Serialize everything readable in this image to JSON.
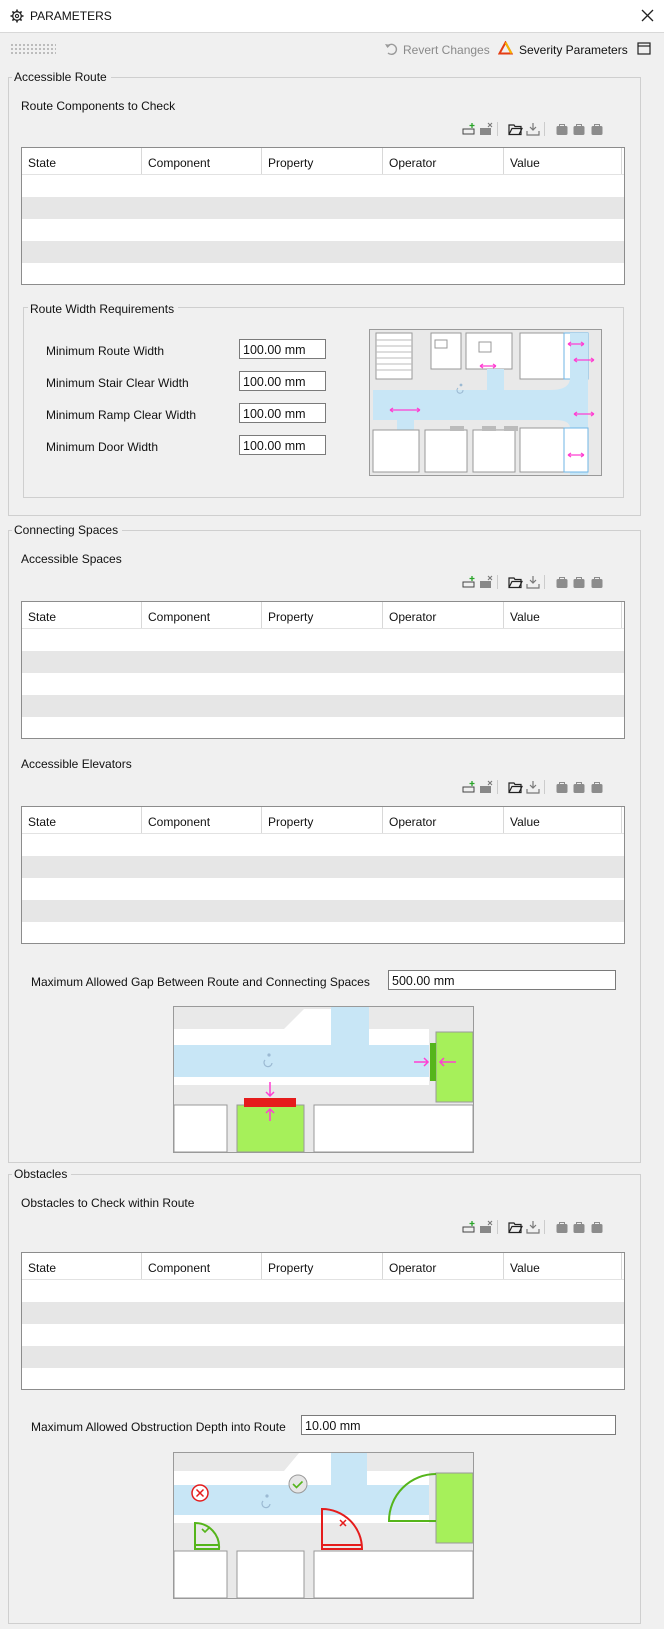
{
  "window": {
    "title": "PARAMETERS"
  },
  "toolbar": {
    "revert_label": "Revert Changes",
    "severity_label": "Severity Parameters"
  },
  "table_columns": [
    "State",
    "Component",
    "Property",
    "Operator",
    "Value"
  ],
  "accessible_route": {
    "title": "Accessible Route",
    "components_label": "Route Components to Check",
    "width_group": {
      "title": "Route Width Requirements",
      "fields": [
        {
          "label": "Minimum Route Width",
          "value": "100.00 mm"
        },
        {
          "label": "Minimum Stair Clear Width",
          "value": "100.00 mm"
        },
        {
          "label": "Minimum Ramp Clear Width",
          "value": "100.00 mm"
        },
        {
          "label": "Minimum Door Width",
          "value": "100.00 mm"
        }
      ]
    }
  },
  "connecting_spaces": {
    "title": "Connecting Spaces",
    "spaces_label": "Accessible Spaces",
    "elevators_label": "Accessible Elevators",
    "gap_label": "Maximum Allowed Gap Between Route and Connecting Spaces",
    "gap_value": "500.00 mm"
  },
  "obstacles": {
    "title": "Obstacles",
    "check_label": "Obstacles to Check within Route",
    "depth_label": "Maximum Allowed Obstruction Depth into Route",
    "depth_value": "10.00 mm"
  },
  "icons": [
    "gear-icon",
    "close-icon",
    "drag-handle-icon",
    "revert-icon",
    "warning-triangle-icon",
    "window-icon",
    "add-row-icon",
    "remove-row-icon",
    "folder-open-icon",
    "download-icon",
    "bag-icon",
    "wheelchair-icon",
    "elevator-icon"
  ],
  "colors": {
    "route": "#c8e6f6",
    "accessible_space": "#a6f05a",
    "arrow": "#ff3fd2",
    "error": "#e51c1c",
    "ok": "#55b51b"
  }
}
